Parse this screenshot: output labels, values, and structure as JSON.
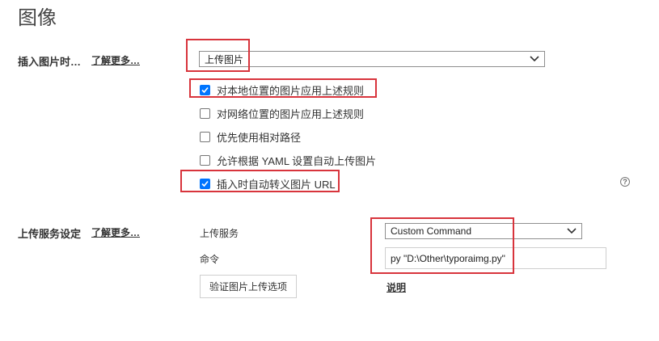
{
  "page": {
    "title": "图像"
  },
  "insert_image": {
    "label": "插入图片时…",
    "learn_more": "了解更多…",
    "action_select": {
      "value": "上传图片"
    },
    "options": [
      {
        "label": "对本地位置的图片应用上述规则",
        "checked": true
      },
      {
        "label": "对网络位置的图片应用上述规则",
        "checked": false
      },
      {
        "label": "优先使用相对路径",
        "checked": false
      },
      {
        "label": "允许根据 YAML 设置自动上传图片",
        "checked": false
      },
      {
        "label": "插入时自动转义图片 URL",
        "checked": true
      }
    ],
    "help_icon": "?"
  },
  "upload_service": {
    "label": "上传服务设定",
    "learn_more": "了解更多…",
    "service_label": "上传服务",
    "service_select": {
      "value": "Custom Command"
    },
    "command_label": "命令",
    "command_value": "py \"D:\\Other\\typoraimg.py\"",
    "verify_button": "验证图片上传选项",
    "explain_link": "说明"
  },
  "colors": {
    "annotation": "#d8343c",
    "checkbox_checked": "#0075ff"
  }
}
